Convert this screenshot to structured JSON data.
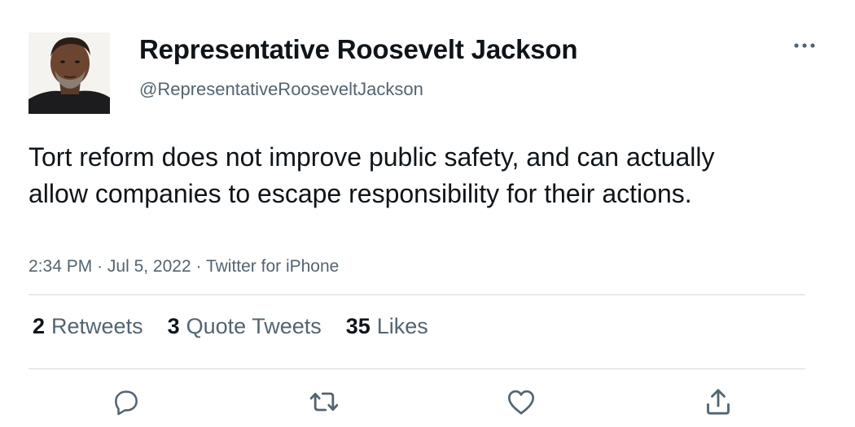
{
  "author": {
    "display_name": "Representative Roosevelt Jackson",
    "handle": "@RepresentativeRooseveltJackson",
    "avatar_icon": "profile-photo"
  },
  "tweet": {
    "text": "Tort reform does not improve public safety, and can actually allow companies to escape responsibility for their actions.",
    "time": "2:34 PM",
    "date": "Jul 5, 2022",
    "source": "Twitter for iPhone",
    "separator": "·"
  },
  "stats": {
    "retweets": {
      "count": "2",
      "label": "Retweets"
    },
    "quotes": {
      "count": "3",
      "label": "Quote Tweets"
    },
    "likes": {
      "count": "35",
      "label": "Likes"
    }
  },
  "actions": {
    "reply_icon": "reply-icon",
    "retweet_icon": "retweet-icon",
    "like_icon": "heart-icon",
    "share_icon": "share-icon"
  },
  "menu": {
    "more_icon": "more-options-icon"
  },
  "colors": {
    "text_primary": "#0f1419",
    "text_secondary": "#536471",
    "divider": "#d4d9dd",
    "icon": "#536471"
  }
}
